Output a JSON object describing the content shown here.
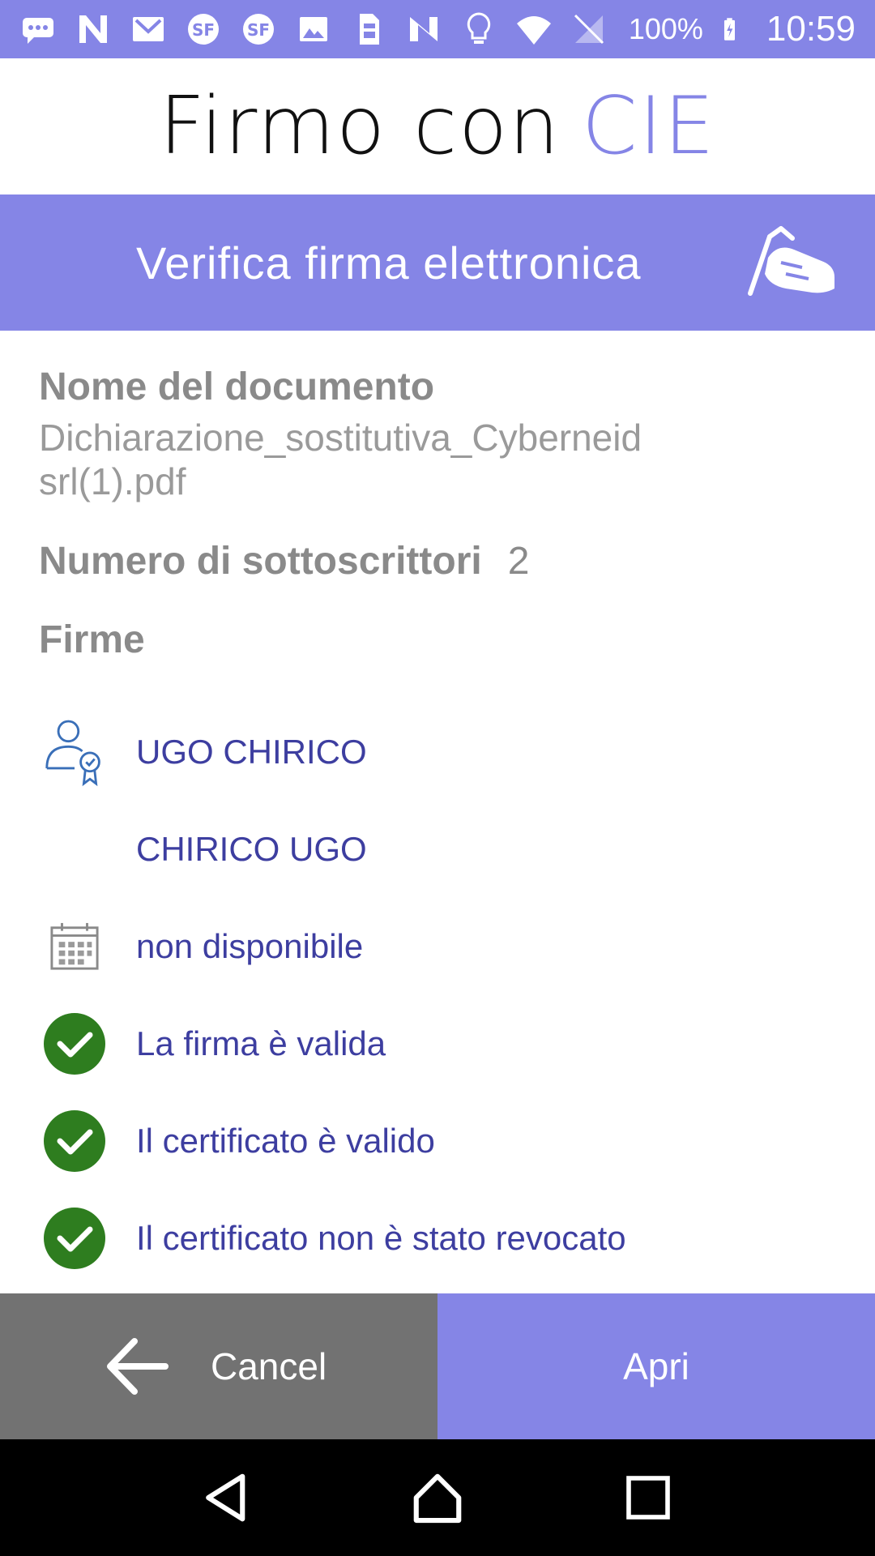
{
  "status_bar": {
    "battery_percent": "100%",
    "time": "10:59",
    "icons": [
      "chat-icon",
      "n-app-icon",
      "mail-icon",
      "sf-icon",
      "sf-icon",
      "image-icon",
      "sim-icon",
      "n-app-icon",
      "bulb-icon",
      "wifi-icon",
      "no-signal-icon",
      "battery-charging-icon"
    ]
  },
  "app": {
    "logo_part1": "Firmo con",
    "logo_part2": "CIE",
    "accent_color": "#8585e6"
  },
  "banner": {
    "title": "Verifica firma elettronica",
    "icon": "signing-hand-icon"
  },
  "document": {
    "name_label": "Nome del documento",
    "name_value": "Dichiarazione_sostitutiva_Cyberneid srl(1).pdf",
    "signers_label": "Numero di sottoscrittori",
    "signers_count": "2",
    "signatures_label": "Firme"
  },
  "signature": {
    "signer_name": "UGO CHIRICO",
    "signer_cn": "CHIRICO UGO",
    "date": "non disponibile",
    "checks": [
      {
        "label": "La firma è valida",
        "status": "ok"
      },
      {
        "label": "Il certificato è valido",
        "status": "ok"
      },
      {
        "label": "Il certificato non è stato revocato",
        "status": "ok"
      }
    ],
    "ok_color": "#2e7d1f",
    "text_color": "#3d3ea0"
  },
  "actions": {
    "cancel_label": "Cancel",
    "open_label": "Apri"
  }
}
